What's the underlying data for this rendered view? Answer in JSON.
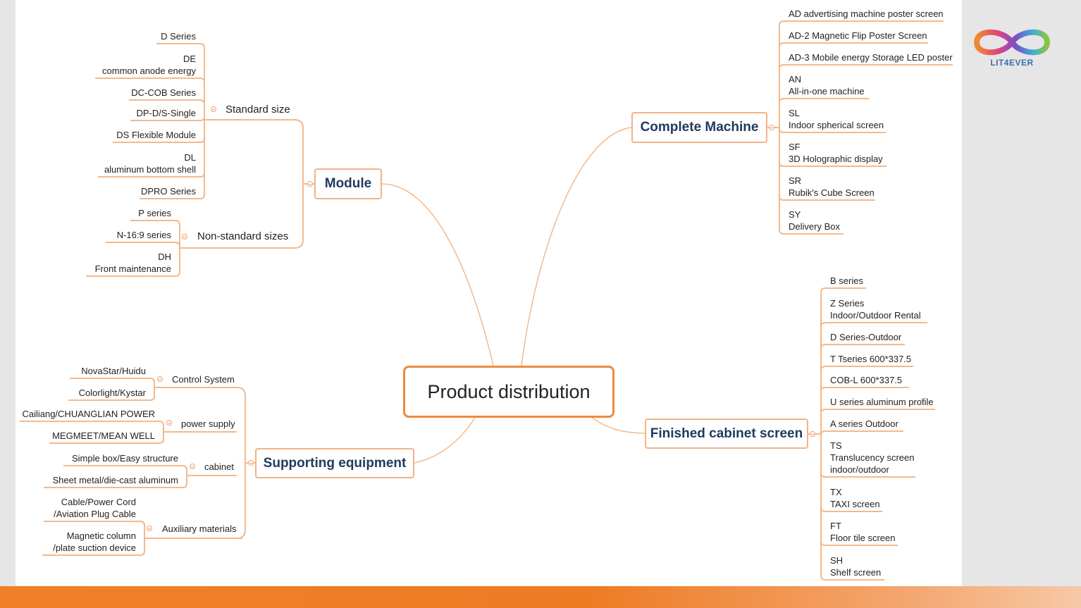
{
  "root": "Product distribution",
  "module": {
    "label": "Module",
    "standard": {
      "label": "Standard size",
      "items": [
        [
          "D Series"
        ],
        [
          "DE",
          "common anode energy"
        ],
        [
          "DC-COB Series"
        ],
        [
          "DP-D/S-Single"
        ],
        [
          "DS Flexible Module"
        ],
        [
          "DL",
          "aluminum bottom shell"
        ],
        [
          "DPRO Series"
        ]
      ]
    },
    "nonstandard": {
      "label": "Non-standard sizes",
      "items": [
        [
          "P series"
        ],
        [
          "N-16:9 series"
        ],
        [
          "DH",
          "Front maintenance"
        ]
      ]
    }
  },
  "complete": {
    "label": "Complete Machine",
    "items": [
      [
        "AD advertising machine poster screen"
      ],
      [
        "AD-2 Magnetic Flip Poster Screen"
      ],
      [
        "AD-3 Mobile energy Storage LED poster"
      ],
      [
        "AN",
        "All-in-one machine"
      ],
      [
        "SL",
        "Indoor spherical screen"
      ],
      [
        "SF",
        "3D Holographic display"
      ],
      [
        "SR",
        "Rubik's Cube Screen"
      ],
      [
        "SY",
        "Delivery Box"
      ]
    ]
  },
  "cabinet": {
    "label": "Finished cabinet screen",
    "items": [
      [
        "B series"
      ],
      [
        "Z Series",
        "Indoor/Outdoor Rental"
      ],
      [
        "D Series-Outdoor"
      ],
      [
        "T Tseries 600*337.5"
      ],
      [
        "COB-L  600*337.5"
      ],
      [
        "U series aluminum profile"
      ],
      [
        "A series Outdoor"
      ],
      [
        "TS",
        "Translucency screen",
        " indoor/outdoor"
      ],
      [
        "TX",
        "TAXI screen"
      ],
      [
        "FT",
        "Floor tile screen"
      ],
      [
        "SH",
        "Shelf screen"
      ]
    ]
  },
  "supporting": {
    "label": "Supporting equipment",
    "groups": [
      {
        "label": "Control System",
        "items": [
          [
            "NovaStar/Huidu"
          ],
          [
            "Colorlight/Kystar"
          ]
        ]
      },
      {
        "label": "power supply",
        "items": [
          [
            "Cailiang/CHUANGLIAN POWER"
          ],
          [
            "MEGMEET/MEAN WELL"
          ]
        ]
      },
      {
        "label": "cabinet",
        "items": [
          [
            "Simple box/Easy structure"
          ],
          [
            "Sheet metal/die-cast aluminum"
          ]
        ]
      },
      {
        "label": "Auxiliary materials",
        "items": [
          [
            "Cable/Power Cord",
            "/Aviation Plug Cable"
          ],
          [
            "Magnetic column",
            "/plate suction device"
          ]
        ]
      }
    ]
  },
  "logo": {
    "text": "LIT4EVER",
    "colors": [
      "#f28a2e",
      "#e0457b",
      "#7b4fc8",
      "#3bb0d8",
      "#8cc63f"
    ]
  },
  "colors": {
    "accent": "#ee8a3c",
    "line": "#f4b98c",
    "node_text": "#1f3a5f",
    "footer": "#ef7f2a"
  }
}
